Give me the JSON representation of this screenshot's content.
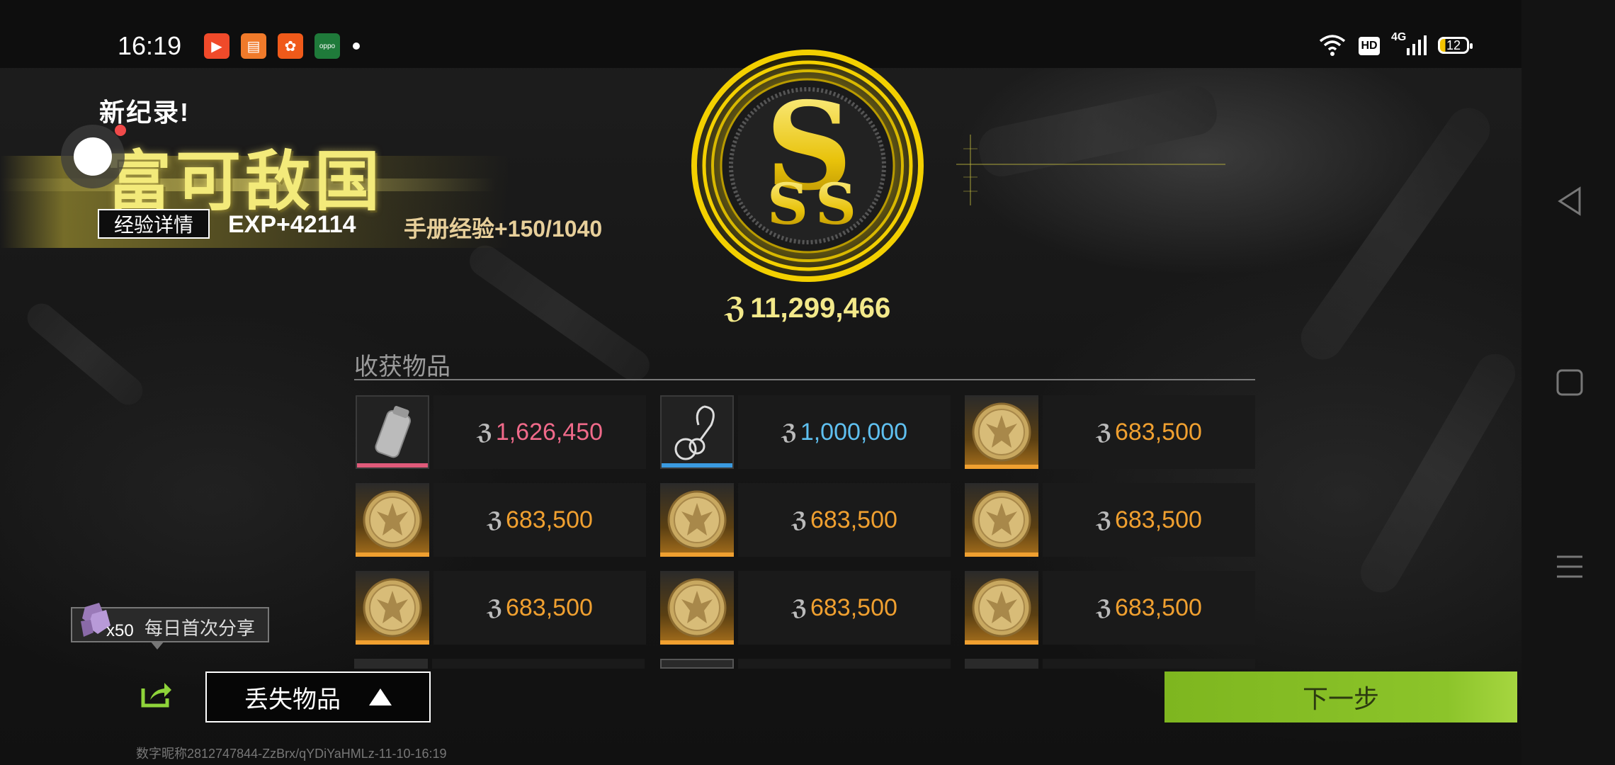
{
  "status_bar": {
    "time": "16:19",
    "network": "4G",
    "hd": "HD",
    "battery": "12",
    "apps": [
      {
        "name": "video-app-icon",
        "color": "#f04a2a"
      },
      {
        "name": "reader-app-icon",
        "color": "#f07a2a"
      },
      {
        "name": "community-app-icon",
        "color": "#f05a1a"
      },
      {
        "name": "oppo-store-icon",
        "color": "#1f7a3a",
        "text": "oppo"
      }
    ]
  },
  "header": {
    "record_label": "新纪录!",
    "achievement_title": "富可敌国",
    "exp_detail_button": "经验详情",
    "exp_value": "EXP+42114",
    "handbook_exp": "手册经验+150/1040"
  },
  "rank": {
    "grade": "SSS",
    "total_value": "11,299,466",
    "accent_color": "#f3d000"
  },
  "items": {
    "title": "收获物品",
    "list": [
      {
        "value": "1,626,450",
        "color": "#f06a8a",
        "rarity_color": "#e05a7a",
        "icon": "canister-icon",
        "thumb": "plain"
      },
      {
        "value": "1,000,000",
        "color": "#5fc0f0",
        "rarity_color": "#3a9ae0",
        "icon": "keychain-icon",
        "thumb": "plain"
      },
      {
        "value": "683,500",
        "color": "#f0a030",
        "rarity_color": "#f0a030",
        "icon": "gold-coin-icon",
        "thumb": "gold"
      },
      {
        "value": "683,500",
        "color": "#f0a030",
        "rarity_color": "#f0a030",
        "icon": "gold-coin-icon",
        "thumb": "gold"
      },
      {
        "value": "683,500",
        "color": "#f0a030",
        "rarity_color": "#f0a030",
        "icon": "gold-coin-icon",
        "thumb": "gold"
      },
      {
        "value": "683,500",
        "color": "#f0a030",
        "rarity_color": "#f0a030",
        "icon": "gold-coin-icon",
        "thumb": "gold"
      },
      {
        "value": "683,500",
        "color": "#f0a030",
        "rarity_color": "#f0a030",
        "icon": "gold-coin-icon",
        "thumb": "gold"
      },
      {
        "value": "683,500",
        "color": "#f0a030",
        "rarity_color": "#f0a030",
        "icon": "gold-coin-icon",
        "thumb": "gold"
      },
      {
        "value": "683,500",
        "color": "#f0a030",
        "rarity_color": "#f0a030",
        "icon": "gold-coin-icon",
        "thumb": "gold"
      }
    ]
  },
  "share": {
    "tooltip": "每日首次分享",
    "reward_count": "x50"
  },
  "footer": {
    "lost_items_button": "丢失物品",
    "next_button": "下一步",
    "player_id": "数字昵称2812747844-ZzBrx/qYDiYaHMLz-11-10-16:19"
  }
}
